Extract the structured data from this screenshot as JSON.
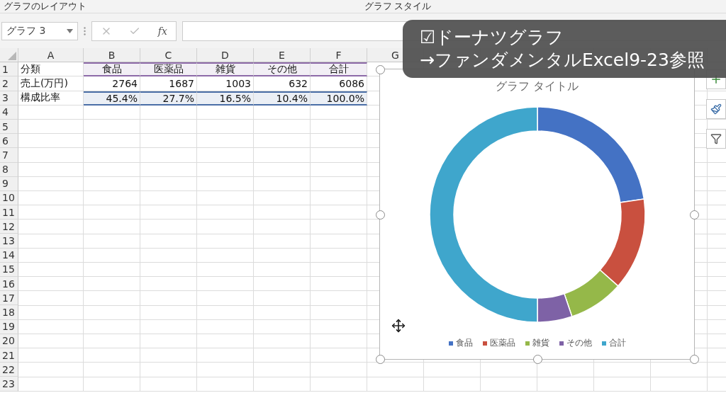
{
  "ribbon": {
    "groups": [
      "グラフのレイアウト",
      "グラフ スタイル"
    ]
  },
  "formula_bar": {
    "name_box": "グラフ 3",
    "fx": "fx"
  },
  "sheet": {
    "columns": [
      "A",
      "B",
      "C",
      "D",
      "E",
      "F",
      "G"
    ],
    "rows": [
      {
        "number": "1",
        "color": "#8d6aa8",
        "cells": [
          "分類",
          "食品",
          "医薬品",
          "雑貨",
          "その他",
          "合計"
        ]
      },
      {
        "number": "2",
        "cells": [
          "売上(万円)",
          "2764",
          "1687",
          "1003",
          "632",
          "6086"
        ]
      },
      {
        "number": "3",
        "color": "#4a6ea6",
        "cells": [
          "構成比率",
          "45.4%",
          "27.7%",
          "16.5%",
          "10.4%",
          "100.0%"
        ]
      },
      {
        "number": "4",
        "cells": []
      },
      {
        "number": "5",
        "cells": []
      },
      {
        "number": "6",
        "cells": []
      },
      {
        "number": "7",
        "cells": []
      },
      {
        "number": "8",
        "cells": []
      },
      {
        "number": "9",
        "cells": []
      },
      {
        "number": "10",
        "cells": []
      },
      {
        "number": "11",
        "cells": []
      },
      {
        "number": "12",
        "cells": []
      },
      {
        "number": "13",
        "cells": []
      },
      {
        "number": "14",
        "cells": []
      },
      {
        "number": "15",
        "cells": []
      },
      {
        "number": "16",
        "cells": []
      },
      {
        "number": "17",
        "cells": []
      },
      {
        "number": "18",
        "cells": []
      },
      {
        "number": "19",
        "cells": []
      },
      {
        "number": "20",
        "cells": []
      },
      {
        "number": "21",
        "cells": []
      },
      {
        "number": "22",
        "cells": []
      },
      {
        "number": "23",
        "cells": []
      }
    ]
  },
  "chart": {
    "selected": true,
    "chart_data": {
      "type": "donut",
      "title": "グラフ タイトル",
      "categories": [
        "食品",
        "医薬品",
        "雑貨",
        "その他",
        "合計"
      ],
      "colors": [
        "#4472c4",
        "#c9503f",
        "#95b849",
        "#7e62a6",
        "#3fa6cc"
      ],
      "values": [
        22.7,
        13.85,
        8.25,
        5.2,
        50
      ]
    }
  },
  "caption": [
    "☑ドーナツグラフ",
    "→ファンダメンタルExcel9-23参照"
  ]
}
